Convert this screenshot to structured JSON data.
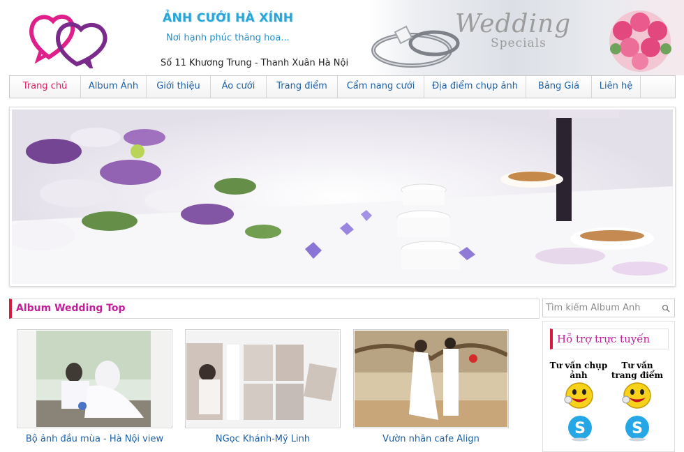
{
  "header": {
    "title": "ẢNH CƯỚI HÀ XÍNH",
    "slogan": "Nơi hạnh phúc thăng hoa...",
    "address": "Số 11 Khương Trung - Thanh Xuân Hà Nội",
    "banner_word_1": "Wedding",
    "banner_word_2": "Specials"
  },
  "nav": {
    "items": [
      {
        "label": "Trang chủ",
        "active": true
      },
      {
        "label": "Album Ảnh"
      },
      {
        "label": "Giới thiệu"
      },
      {
        "label": "Áo cưới"
      },
      {
        "label": "Trang điểm"
      },
      {
        "label": "Cẩm nang cưới"
      },
      {
        "label": "Địa điểm chụp ảnh"
      },
      {
        "label": "Bảng Giá"
      },
      {
        "label": "Liên hệ"
      }
    ]
  },
  "album": {
    "title": "Album Wedding Top",
    "items": [
      {
        "caption": "Bộ ảnh đầu mùa - Hà Nội view"
      },
      {
        "caption": "NGọc Khánh-Mỹ Linh"
      },
      {
        "caption": "Vườn nhãn cafe Align"
      }
    ]
  },
  "search": {
    "placeholder": "Tìm kiếm Album Ảnh"
  },
  "support": {
    "title": "Hỗ trợ trực tuyến",
    "contacts": [
      {
        "label": "Tư vấn chụp ảnh",
        "icons": [
          "yahoo-messenger-icon",
          "skype-icon"
        ]
      },
      {
        "label": "Tư vấn trang điểm",
        "icons": [
          "yahoo-messenger-icon",
          "skype-icon"
        ]
      }
    ]
  },
  "colors": {
    "accent_red": "#d8193f",
    "link_blue": "#1c5fa5",
    "title_magenta": "#c41e9a",
    "header_blue": "#2aa5d8"
  }
}
